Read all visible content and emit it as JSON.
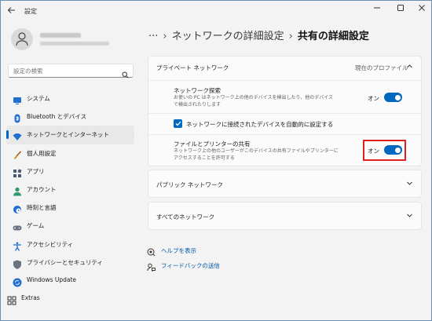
{
  "window": {
    "title": "設定",
    "back_icon": "back-arrow-icon"
  },
  "search": {
    "placeholder": "設定の検索"
  },
  "nav": {
    "items": [
      {
        "label": "システム",
        "icon": "monitor-icon",
        "color": "#1f6fd1"
      },
      {
        "label": "Bluetooth とデバイス",
        "icon": "bluetooth-icon",
        "color": "#1f6fd1"
      },
      {
        "label": "ネットワークとインターネット",
        "icon": "wifi-icon",
        "color": "#1f6fd1",
        "active": true
      },
      {
        "label": "個人用設定",
        "icon": "brush-icon",
        "color": "#d98a1a"
      },
      {
        "label": "アプリ",
        "icon": "apps-icon",
        "color": "#4a5a72"
      },
      {
        "label": "アカウント",
        "icon": "person-icon",
        "color": "#2e9a6a"
      },
      {
        "label": "時刻と言語",
        "icon": "globe-clock-icon",
        "color": "#1f6fd1"
      },
      {
        "label": "ゲーム",
        "icon": "gamepad-icon",
        "color": "#6b7280"
      },
      {
        "label": "アクセシビリティ",
        "icon": "accessibility-icon",
        "color": "#1f6fd1"
      },
      {
        "label": "プライバシーとセキュリティ",
        "icon": "shield-icon",
        "color": "#6b7280"
      },
      {
        "label": "Windows Update",
        "icon": "update-icon",
        "color": "#1f6fd1"
      },
      {
        "label": "Extras",
        "icon": "extras-icon",
        "color": "#333333"
      }
    ]
  },
  "breadcrumb": {
    "ellipsis": "···",
    "parent": "ネットワークの詳細設定",
    "current": "共有の詳細設定"
  },
  "private_network": {
    "title": "プライベート ネットワーク",
    "status": "現在のプロファイル",
    "discovery": {
      "title": "ネットワーク探索",
      "desc": "お使いの PC はネットワーク上の他のデバイスを検出したり、他のデバイスで検出されたりします",
      "state": "オン"
    },
    "auto_setup": {
      "label": "ネットワークに接続されたデバイスを自動的に設定する",
      "checked": true
    },
    "sharing": {
      "title": "ファイルとプリンターの共有",
      "desc": "ネットワーク上の他のユーザーがこのデバイスの共有ファイルやプリンターにアクセスすることを許可する",
      "state": "オン"
    }
  },
  "public_network": {
    "title": "パブリック ネットワーク"
  },
  "all_networks": {
    "title": "すべてのネットワーク"
  },
  "links": {
    "help": "ヘルプを表示",
    "feedback": "フィードバックの送信"
  },
  "colors": {
    "accent": "#0067c0",
    "highlight": "#e0211f"
  }
}
